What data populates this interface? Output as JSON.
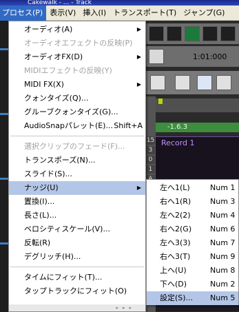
{
  "title_text": "Cakewalk - ... - Track",
  "menubar": {
    "items": [
      "プロセス(P)",
      "表示(V)",
      "挿入(I)",
      "トランスポート(T)",
      "ジャンプ(G)"
    ],
    "active_index": 0
  },
  "daw": {
    "time_readout": "1:01:000",
    "clip_marker_label": "-1.6.3",
    "clip_record_label": "Record 1",
    "track_numbers": [
      "15",
      "3",
      "0",
      "1",
      "A"
    ]
  },
  "process_menu": {
    "items": [
      {
        "label": "オーディオ(A)",
        "submenu": true,
        "enabled": true
      },
      {
        "label": "オーディオエフェクトの反映(P)",
        "enabled": false
      },
      {
        "label": "オーディオFX(D)",
        "submenu": true,
        "enabled": true
      },
      {
        "label": "MIDIエフェクトの反映(Y)",
        "enabled": false
      },
      {
        "label": "MIDI FX(X)",
        "submenu": true,
        "enabled": true
      },
      {
        "label": "クォンタイズ(Q)...",
        "enabled": true
      },
      {
        "label": "グルーブクォンタイズ(G)...",
        "enabled": true
      },
      {
        "label": "AudioSnapパレット(E)...",
        "shortcut": "Shift+A",
        "enabled": true
      },
      {
        "label": "選択クリップのフェード(F)...",
        "enabled": false
      },
      {
        "label": "トランスポーズ(N)...",
        "enabled": true
      },
      {
        "label": "スライド(S)...",
        "enabled": true
      },
      {
        "label": "ナッジ(U)",
        "submenu": true,
        "enabled": true,
        "highlighted": true
      },
      {
        "label": "置換(I)...",
        "enabled": true
      },
      {
        "label": "長さ(L)...",
        "enabled": true
      },
      {
        "label": "ベロシティスケール(V)...",
        "enabled": true
      },
      {
        "label": "反転(R)",
        "enabled": true
      },
      {
        "label": "デグリッチ(H)...",
        "enabled": true
      },
      {
        "label": "タイムにフィット(T)...",
        "enabled": true
      },
      {
        "label": "タップトラックにフィット(O)",
        "enabled": true
      }
    ]
  },
  "nudge_submenu": {
    "items": [
      {
        "label": "左へ1(L)",
        "shortcut": "Num 1"
      },
      {
        "label": "右へ1(R)",
        "shortcut": "Num 3"
      },
      {
        "label": "左へ2(2)",
        "shortcut": "Num 4"
      },
      {
        "label": "右へ2(G)",
        "shortcut": "Num 6"
      },
      {
        "label": "左へ3(3)",
        "shortcut": "Num 7"
      },
      {
        "label": "右へ3(T)",
        "shortcut": "Num 9"
      },
      {
        "label": "上へ(U)",
        "shortcut": "Num 8"
      },
      {
        "label": "下へ(D)",
        "shortcut": "Num 2"
      },
      {
        "label": "設定(S)...",
        "shortcut": "Num 5",
        "highlighted": true
      }
    ]
  },
  "colors": {
    "menu_highlight": "#b4c6e7",
    "menubar_active": "#316ac5",
    "disabled_text": "#a0a0a0"
  }
}
